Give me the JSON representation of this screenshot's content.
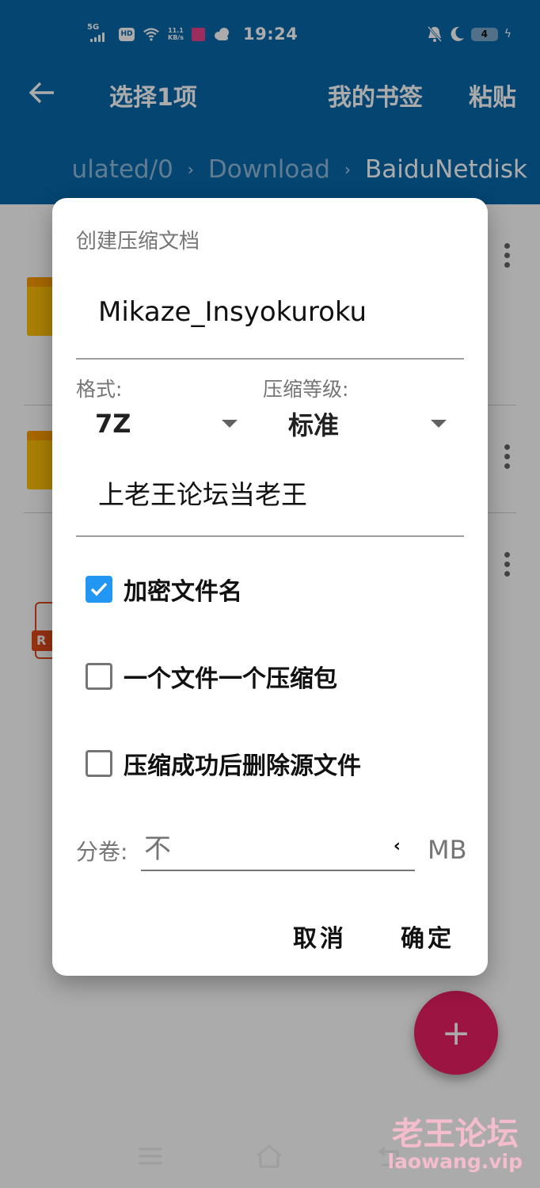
{
  "status_bar": {
    "network": "5G",
    "hd_badge": "HD",
    "speed_value": "11.1",
    "speed_unit": "KB/s",
    "time": "19:24",
    "battery_level": "4",
    "icons": [
      "signal-icon",
      "hd-icon",
      "wifi-icon",
      "app-notification-icon",
      "weather-cloud-icon",
      "bell-off-icon",
      "moon-icon",
      "battery-icon",
      "charging-icon"
    ]
  },
  "app_bar": {
    "back_icon": "←",
    "title": "选择1项",
    "actions": [
      "我的书签",
      "粘贴"
    ]
  },
  "breadcrumb": {
    "items": [
      "ulated/0",
      "Download",
      "BaiduNetdisk"
    ],
    "separator": "›"
  },
  "file_list": {
    "rows": [
      {
        "type": "folder",
        "icon": "folder-icon"
      },
      {
        "type": "folder",
        "icon": "folder-icon"
      },
      {
        "type": "archive",
        "icon": "rar-file-icon",
        "badge": "R"
      }
    ]
  },
  "dialog": {
    "title": "创建压缩文档",
    "archive_name": "Mikaze_Insyokuroku",
    "format_label": "格式:",
    "format_value": "7Z",
    "level_label": "压缩等级:",
    "level_value": "标准",
    "password": "上老王论坛当老王",
    "options": [
      {
        "label": "加密文件名",
        "checked": true
      },
      {
        "label": "一个文件一个压缩包",
        "checked": false
      },
      {
        "label": "压缩成功后删除源文件",
        "checked": false
      }
    ],
    "split_label": "分卷:",
    "split_value": "不",
    "split_chevron": "‹",
    "split_unit": "MB",
    "cancel_label": "取消",
    "ok_label": "确定"
  },
  "fab": {
    "label": "+"
  },
  "watermark": {
    "cn": "老王论坛",
    "url": "laowang.vip"
  },
  "colors": {
    "app_bar": "#0767ab",
    "accent": "#2196f3",
    "fab": "#e91e63",
    "folder": "#fec007",
    "rar": "#e2491a"
  }
}
